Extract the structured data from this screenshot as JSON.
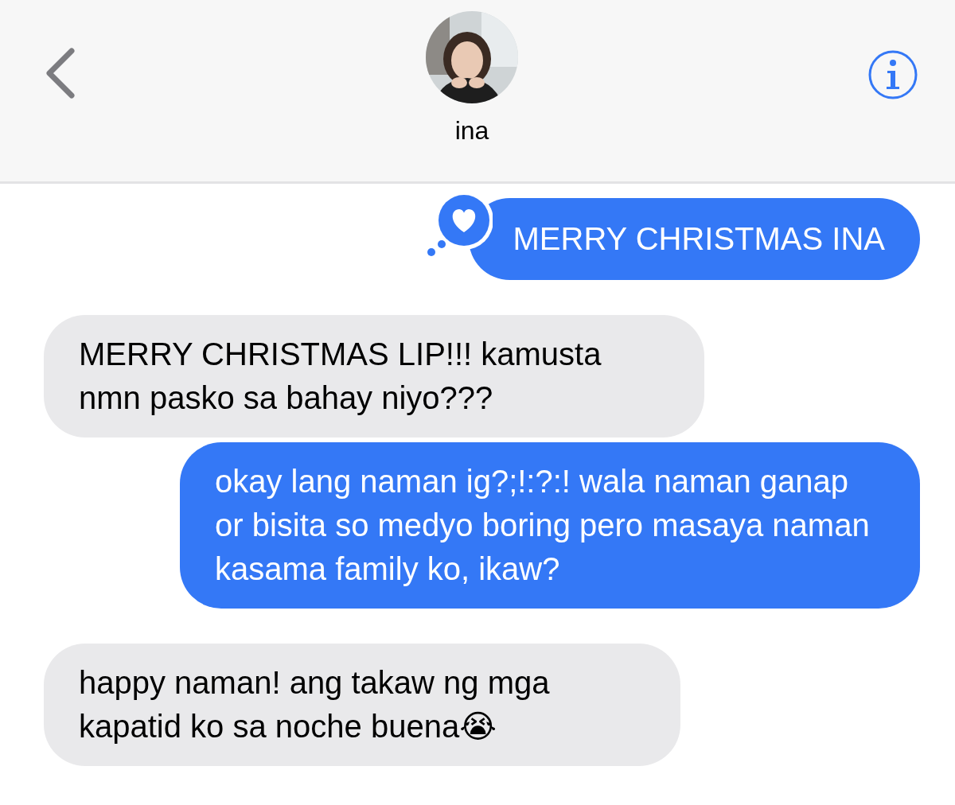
{
  "header": {
    "contact_name": "ina"
  },
  "messages": [
    {
      "kind": "sent",
      "text": "MERRY CHRISTMAS INA",
      "hearted": true
    },
    {
      "kind": "received",
      "text": "MERRY CHRISTMAS LIP!!! kamusta nmn pasko sa bahay niyo???"
    },
    {
      "kind": "sent",
      "text": "okay lang naman ig?;!:?:! wala naman ganap or bisita so medyo boring pero masaya naman kasama family ko, ikaw?"
    },
    {
      "kind": "received",
      "text": "happy naman! ang takaw ng mga kapatid ko sa noche buena😭"
    }
  ]
}
